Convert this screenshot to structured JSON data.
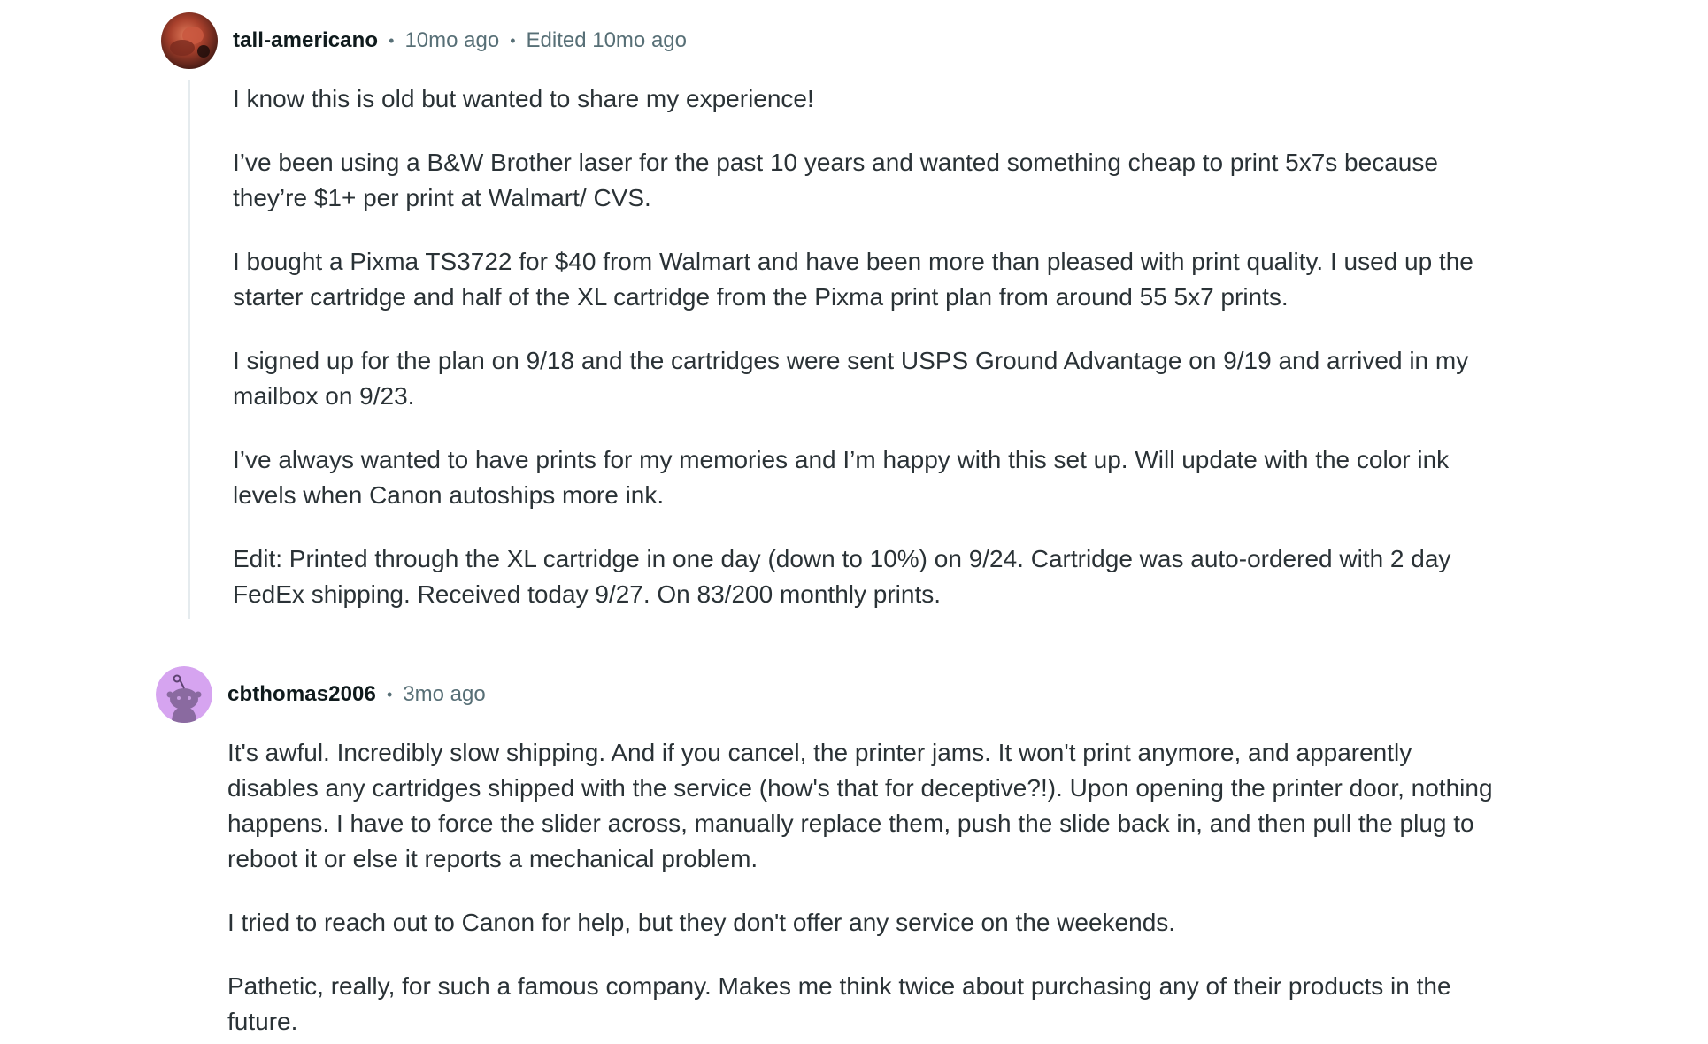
{
  "comments": [
    {
      "username": "tall-americano",
      "time": "10mo ago",
      "edited": "Edited 10mo ago",
      "avatar_icon": "user-avatar-photo",
      "paragraphs": [
        "I know this is old but wanted to share my experience!",
        "I’ve been using a B&W Brother laser for the past 10 years and wanted something cheap to print 5x7s because they’re $1+ per print at Walmart/ CVS.",
        "I bought a Pixma TS3722 for $40 from Walmart and have been more than pleased with print quality. I used up the starter cartridge and half of the XL cartridge from the Pixma print plan from around 55 5x7 prints.",
        "I signed up for the plan on 9/18 and the cartridges were sent USPS Ground Advantage on 9/19 and arrived in my mailbox on 9/23.",
        "I’ve always wanted to have prints for my memories and I’m happy with this set up. Will update with the color ink levels when Canon autoships more ink.",
        "Edit: Printed through the XL cartridge in one day (down to 10%) on 9/24. Cartridge was auto-ordered with 2 day FedEx shipping. Received today 9/27. On 83/200 monthly prints."
      ]
    },
    {
      "username": "cbthomas2006",
      "time": "3mo ago",
      "avatar_icon": "snoo-avatar-icon",
      "paragraphs": [
        "It's awful. Incredibly slow shipping. And if you cancel, the printer jams. It won't print anymore, and apparently disables any cartridges shipped with the service (how's that for deceptive?!). Upon opening the printer door, nothing happens. I have to force the slider across, manually replace them, push the slide back in, and then pull the plug to reboot it or else it reports a mechanical problem.",
        "I tried to reach out to Canon for help, but they don't offer any service on the weekends.",
        "Pathetic, really, for such a famous company. Makes me think twice about purchasing any of their products in the future."
      ]
    }
  ],
  "separator": "•",
  "colors": {
    "username": "#0f1a1c",
    "meta": "#576f76",
    "body": "#2a3236",
    "thread_line": "#e5ebee",
    "snoo_bg": "#d6a4f0"
  }
}
